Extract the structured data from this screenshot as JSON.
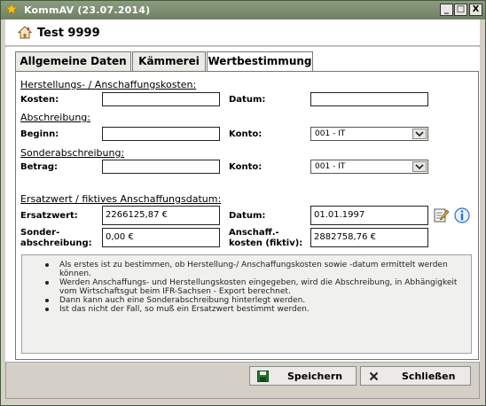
{
  "window": {
    "title": "KommAV (23.07.2014)",
    "buttons": {
      "minimize": "_",
      "maximize": "□",
      "close": "X"
    }
  },
  "record": {
    "title": "Test 9999"
  },
  "tabs": [
    {
      "label": "Allgemeine Daten",
      "active": false
    },
    {
      "label": "Kämmerei",
      "active": false
    },
    {
      "label": "Wertbestimmung",
      "active": true
    }
  ],
  "herstellung": {
    "section_label": "Herstellungs- / Anschaffungskosten:",
    "kosten_label": "Kosten:",
    "kosten_value": "",
    "datum_label": "Datum:",
    "datum_value": ""
  },
  "abschreibung": {
    "section_label": "Abschreibung:",
    "beginn_label": "Beginn:",
    "beginn_value": "",
    "konto_label": "Konto:",
    "konto_value": "001 - IT"
  },
  "sonderabschreibung": {
    "section_label": "Sonderabschreibung:",
    "betrag_label": "Betrag:",
    "betrag_value": "",
    "konto_label": "Konto:",
    "konto_value": "001 - IT"
  },
  "ersatzwert": {
    "section_label": "Ersatzwert / fiktives Anschaffungsdatum:",
    "ersatzwert_label": "Ersatzwert:",
    "ersatzwert_value": "2266125,87 €",
    "datum_label": "Datum:",
    "datum_value": "01.01.1997",
    "sonder_label_1": "Sonder-",
    "sonder_label_2": "abschreibung:",
    "sonder_value": "0,00 €",
    "anschaff_label_1": "Anschaff.-",
    "anschaff_label_2": "kosten (fiktiv):",
    "anschaff_value": "2882758,76 €"
  },
  "info": {
    "items": [
      "Als erstes ist zu bestimmen, ob Herstellung-/ Anschaffungskosten sowie -datum ermittelt werden können.",
      "Werden Anschaffungs- und Herstellungskosten eingegeben, wird die Abschreibung, in Abhängigkeit vom Wirtschaftsgut beim IFR-Sachsen - Export berechnet.",
      "Dann kann auch eine Sonderabschreibung hinterlegt werden.",
      "Ist das nicht der Fall, so muß ein Ersatzwert bestimmt werden."
    ]
  },
  "footer": {
    "save_label": "Speichern",
    "close_label": "Schließen"
  },
  "colors": {
    "titlebar": "#7a8a6c",
    "window_bg": "#d4d0c8",
    "panel_bg": "#ffffff",
    "save_icon": "#1f7a2a",
    "info_icon": "#2a6fc9"
  },
  "icons": {
    "app": "star-icon",
    "record": "house-icon",
    "edit": "edit-note-icon",
    "info": "info-icon",
    "save": "floppy-disk-icon",
    "close": "x-icon"
  }
}
